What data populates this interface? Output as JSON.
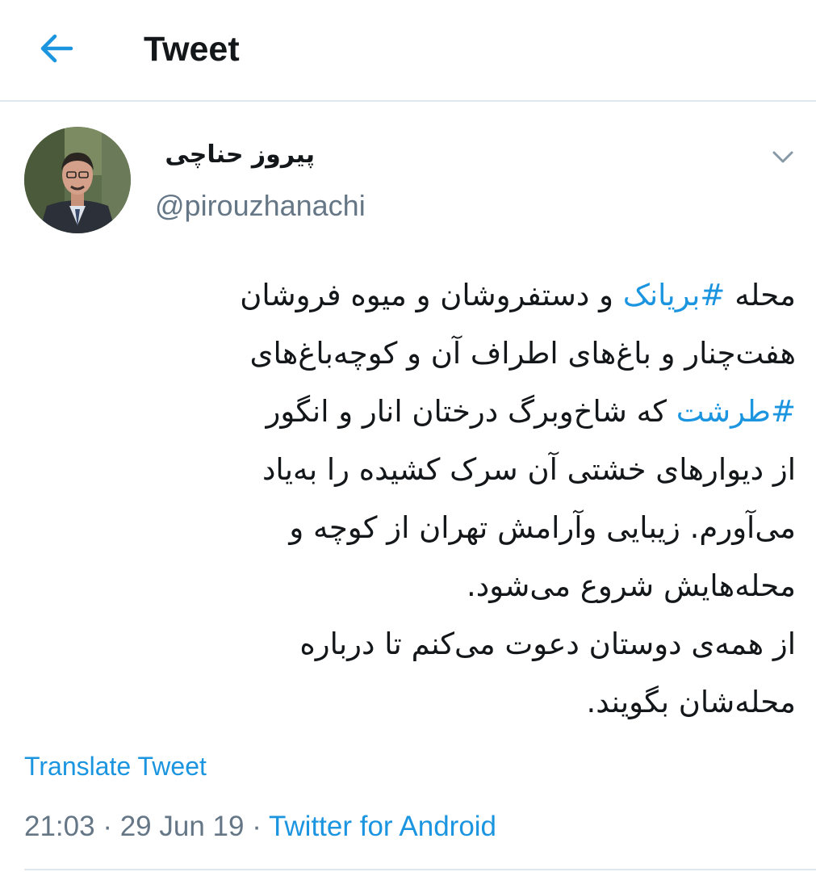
{
  "header": {
    "title": "Tweet",
    "back_icon": "arrow-left-icon",
    "accent": "#1b95e0"
  },
  "author": {
    "display_name": "پیروز حناچی",
    "handle": "@pirouzhanachi",
    "avatar": "avatar-photo"
  },
  "tweet": {
    "lines": [
      [
        {
          "text": "محله "
        },
        {
          "text": "#بریانک",
          "hashtag": true
        },
        {
          "text": " و دستفروشان و میوه فروشان"
        }
      ],
      [
        {
          "text": "هفت‌چنار و باغ‌های اطراف آن و کوچه‌باغ‌های"
        }
      ],
      [
        {
          "text": "#طرشت",
          "hashtag": true
        },
        {
          "text": " که شاخ‌وبرگ درختان انار و انگور"
        }
      ],
      [
        {
          "text": "از دیوارهای خشتی آن سرک کشیده را به‌یاد"
        }
      ],
      [
        {
          "text": "می‌آورم. زیبایی وآرامش تهران از کوچه و"
        }
      ],
      [
        {
          "text": "محله‌هایش شروع می‌شود."
        }
      ],
      [
        {
          "text": "از همه‌ی دوستان دعوت می‌کنم تا درباره"
        }
      ],
      [
        {
          "text": "محله‌شان بگویند."
        }
      ]
    ],
    "translate_label": "Translate Tweet"
  },
  "meta": {
    "time": "21:03",
    "separator": "·",
    "date": "29 Jun 19",
    "source": "Twitter for Android"
  }
}
